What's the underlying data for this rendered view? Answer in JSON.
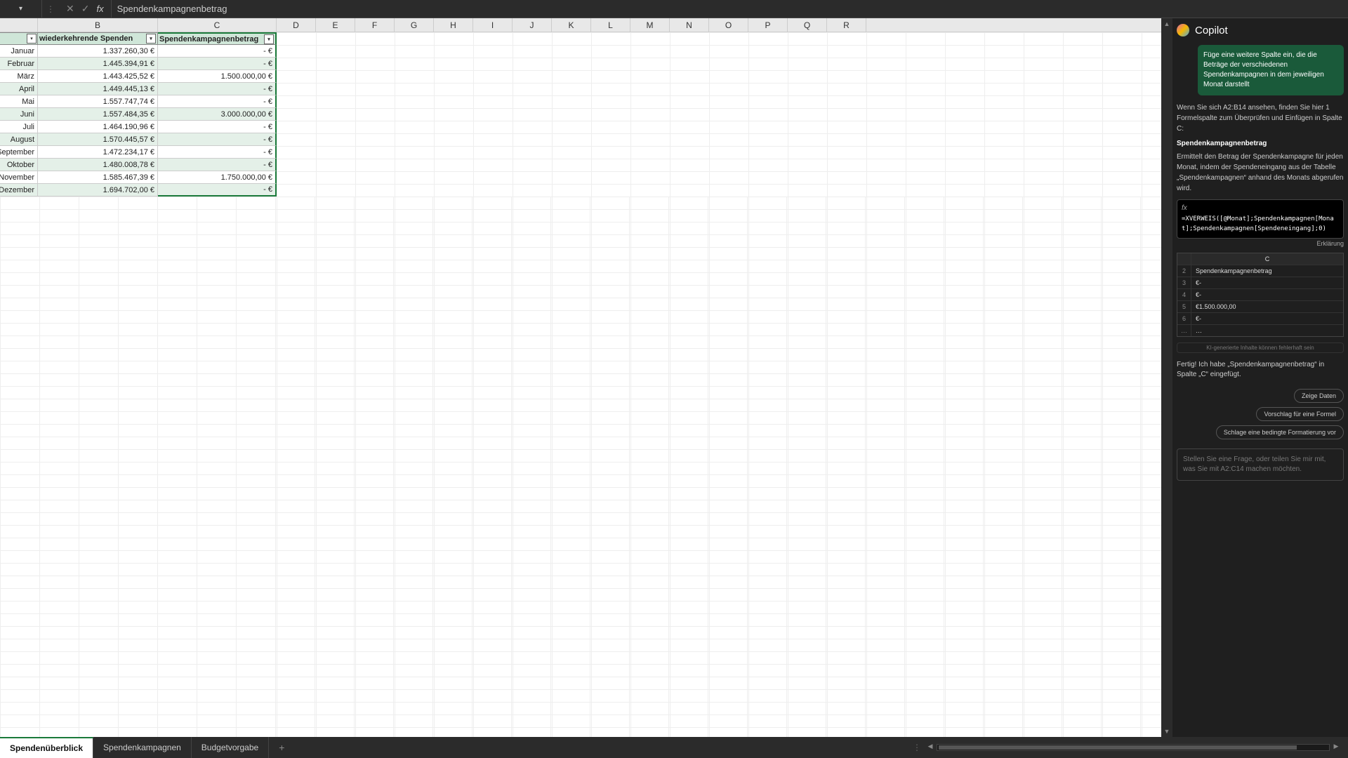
{
  "formula_bar": {
    "value": "Spendenkampagnenbetrag"
  },
  "columns": [
    "B",
    "C",
    "D",
    "E",
    "F",
    "G",
    "H",
    "I",
    "J",
    "K",
    "L",
    "M",
    "N",
    "O",
    "P",
    "Q",
    "R"
  ],
  "table": {
    "header_b": "wiederkehrende Spenden",
    "header_c": "Spendenkampagnenbetrag",
    "rows": [
      {
        "month": "Januar",
        "b": "1.337.260,30 €",
        "c": "-   €"
      },
      {
        "month": "Februar",
        "b": "1.445.394,91 €",
        "c": "-   €"
      },
      {
        "month": "März",
        "b": "1.443.425,52 €",
        "c": "1.500.000,00 €"
      },
      {
        "month": "April",
        "b": "1.449.445,13 €",
        "c": "-   €"
      },
      {
        "month": "Mai",
        "b": "1.557.747,74 €",
        "c": "-   €"
      },
      {
        "month": "Juni",
        "b": "1.557.484,35 €",
        "c": "3.000.000,00 €"
      },
      {
        "month": "Juli",
        "b": "1.464.190,96 €",
        "c": "-   €"
      },
      {
        "month": "August",
        "b": "1.570.445,57 €",
        "c": "-   €"
      },
      {
        "month": "September",
        "b": "1.472.234,17 €",
        "c": "-   €"
      },
      {
        "month": "Oktober",
        "b": "1.480.008,78 €",
        "c": "-   €"
      },
      {
        "month": "November",
        "b": "1.585.467,39 €",
        "c": "1.750.000,00 €"
      },
      {
        "month": "Dezember",
        "b": "1.694.702,00 €",
        "c": "-   €"
      }
    ]
  },
  "sheet_tabs": {
    "active": "Spendenüberblick",
    "tabs": [
      "Spendenüberblick",
      "Spendenkampagnen",
      "Budgetvorgabe"
    ]
  },
  "copilot": {
    "title": "Copilot",
    "user_msg": "Füge eine weitere Spalte ein, die die Beträge der verschiedenen Spendenkampagnen in dem jeweiligen Monat darstellt",
    "intro": "Wenn Sie sich A2:B14 ansehen, finden Sie hier 1 Formelspalte zum Überprüfen und Einfügen in Spalte C:",
    "col_name": "Spendenkampagnenbetrag",
    "col_desc": "Ermittelt den Betrag der Spendenkampagne für jeden Monat, indem der Spendeneingang aus der Tabelle „Spendenkampagnen“ anhand des Monats abgerufen wird.",
    "fx": "fx",
    "formula": "=XVERWEIS([@Monat];Spendenkampagnen[Monat];Spendenkampagnen[Spendeneingang];0)",
    "explain": "Erklärung",
    "preview_head": "C",
    "preview": [
      {
        "idx": "2",
        "val": "Spendenkampagnenbetrag"
      },
      {
        "idx": "3",
        "val": "€‑"
      },
      {
        "idx": "4",
        "val": "€‑"
      },
      {
        "idx": "5",
        "val": "€1.500.000,00"
      },
      {
        "idx": "6",
        "val": "€‑"
      },
      {
        "idx": "…",
        "val": "…"
      }
    ],
    "disclaimer": "KI-generierte Inhalte können fehlerhaft sein",
    "done": "Fertig! Ich habe „Spendenkampagnenbetrag“ in Spalte „C“ eingefügt.",
    "chips": [
      "Zeige Daten",
      "Vorschlag für eine Formel",
      "Schlage eine bedingte Formatierung vor"
    ],
    "ask_placeholder": "Stellen Sie eine Frage, oder teilen Sie mir mit, was Sie mit A2:C14 machen möchten."
  }
}
